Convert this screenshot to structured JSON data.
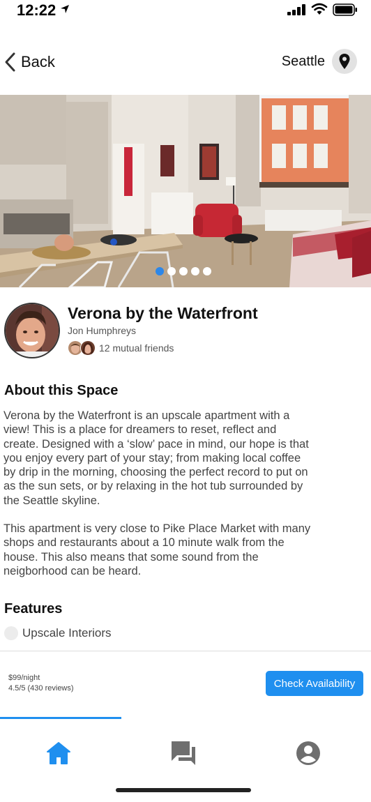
{
  "status_bar": {
    "time": "12:22"
  },
  "header": {
    "back_label": "Back",
    "location_label": "Seattle"
  },
  "listing": {
    "title": "Verona by the Waterfront",
    "host_name": "Jon Humphreys",
    "mutual_friends": "12 mutual friends"
  },
  "gallery": {
    "dot_count": 5,
    "active_dot": 0
  },
  "about": {
    "heading": "About this Space",
    "paragraph_1_lines": [
      "Verona by the Waterfront is an upscale apartment with a",
      "view! This is a place for dreamers to reset, reflect and",
      "create. Designed with a ‘slow’ pace in mind, our hope is that",
      "you enjoy every part of your stay; from making local coffee",
      "by drip in the morning, choosing the perfect record to put on",
      "as the sun sets, or by relaxing in the hot tub surrounded by",
      "the Seattle skyline."
    ],
    "paragraph_2_lines": [
      "This apartment is very close to Pike Place Market with many",
      "shops and restaurants about a 10 minute walk from the",
      "house. This also means that some sound from the",
      "neigborhood can be heard."
    ]
  },
  "features": {
    "heading": "Features",
    "items": [
      "Upscale Interiors"
    ]
  },
  "booking": {
    "price": "$99/night",
    "rating": "4.5/5 (430 reviews)",
    "cta_label": "Check Availability"
  },
  "tabbar": {
    "active_tab": "home",
    "tabs": [
      {
        "icon": "home-icon"
      },
      {
        "icon": "chat-icon"
      },
      {
        "icon": "account-icon"
      }
    ]
  },
  "colors": {
    "accent": "#1f8fef",
    "dot_active": "#2d87e8",
    "text": "#111111",
    "muted": "#555555"
  }
}
